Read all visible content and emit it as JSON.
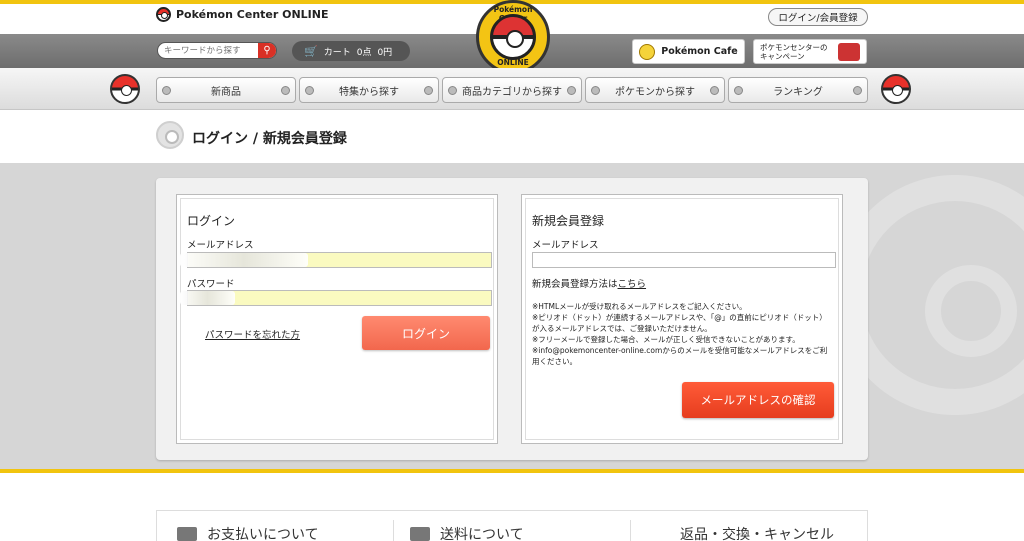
{
  "header": {
    "brand": "Pokémon Center ONLINE",
    "login_register": "ログイン/会員登録",
    "search_placeholder": "キーワードから探す",
    "cart_label": "カート",
    "cart_count": "0点",
    "cart_price": "0円",
    "logo_top": "Pokémon Center",
    "logo_bottom": "ONLINE",
    "cafe": "Pokémon Cafe",
    "campaign_line1": "ポケモンセンターの",
    "campaign_line2": "キャンペーン"
  },
  "nav": {
    "items": [
      "新商品",
      "特集から探す",
      "商品カテゴリから探す",
      "ポケモンから探す",
      "ランキング"
    ]
  },
  "page": {
    "title": "ログイン / 新規会員登録"
  },
  "login": {
    "heading": "ログイン",
    "email_label": "メールアドレス",
    "password_label": "パスワード",
    "forgot": "パスワードを忘れた方",
    "submit": "ログイン"
  },
  "register": {
    "heading": "新規会員登録",
    "email_label": "メールアドレス",
    "howto_prefix": "新規会員登録方法は",
    "howto_link": "こちら",
    "notes": [
      "※HTMLメールが受け取れるメールアドレスをご記入ください。",
      "※ピリオド（ドット）が連続するメールアドレスや、「@」の直前にピリオド（ドット）が入るメールアドレスでは、ご登録いただけません。",
      "※フリーメールで登録した場合、メールが正しく受信できないことがあります。",
      "※info@pokemoncenter-online.comからのメールを受信可能なメールアドレスをご利用ください。"
    ],
    "confirm": "メールアドレスの確認"
  },
  "footer": {
    "items": [
      "お支払いについて",
      "送料について",
      "返品・交換・キャンセル"
    ]
  },
  "colors": {
    "accent_yellow": "#f1c40f",
    "login_button": "#f2674d",
    "confirm_button": "#e63d1e"
  }
}
